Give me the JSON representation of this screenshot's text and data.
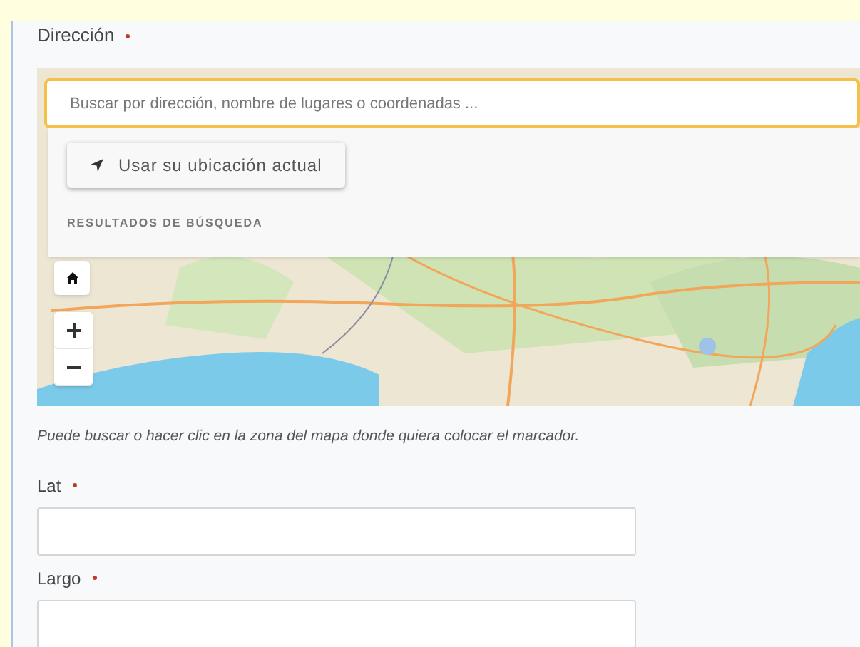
{
  "address": {
    "label": "Dirección",
    "required": true,
    "search": {
      "placeholder": "Buscar por dirección, nombre de lugares o coordenadas ...",
      "focused": true
    },
    "locate_button": "Usar su ubicación actual",
    "results_heading": "RESULTADOS DE BÚSQUEDA",
    "map_controls": [
      {
        "kind": "home"
      },
      {
        "kind": "zoom-in"
      },
      {
        "kind": "zoom-out"
      }
    ],
    "hint": "Puede buscar o hacer clic en la zona del mapa donde quiera colocar el marcador."
  },
  "fields": [
    {
      "label": "Lat",
      "required": true
    },
    {
      "label": "Largo",
      "required": true
    }
  ]
}
